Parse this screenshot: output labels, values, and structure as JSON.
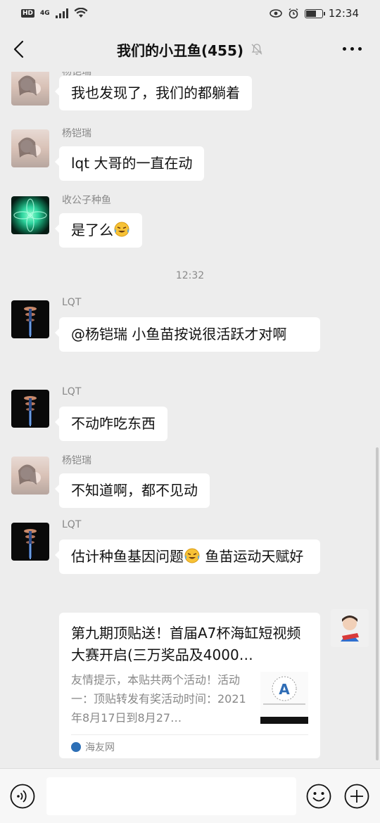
{
  "status_bar": {
    "hd_badge": "HD",
    "network": "4G",
    "time": "12:34",
    "battery_level": 0.65
  },
  "header": {
    "title": "我们的小丑鱼(455)",
    "muted": true
  },
  "messages": [
    {
      "sender": "杨铠瑞",
      "text": "我也发现了，我们的都躺着",
      "avatar": "girl"
    },
    {
      "sender": "杨铠瑞",
      "text": "lqt 大哥的一直在动",
      "avatar": "girl"
    },
    {
      "sender": "收公子种鱼",
      "text": "是了么",
      "emoji": "laugh-cry",
      "avatar": "lotus"
    },
    {
      "sender": "LQT",
      "text": "@杨铠瑞  小鱼苗按说很活跃才对啊",
      "avatar": "lqt"
    },
    {
      "sender": "LQT",
      "text": "不动咋吃东西",
      "avatar": "lqt"
    },
    {
      "sender": "杨铠瑞",
      "text": "不知道啊，都不见动",
      "avatar": "girl"
    },
    {
      "sender": "LQT",
      "text_before_emoji": "估计种鱼基因问题",
      "text_after_emoji": " 鱼苗运动天赋好",
      "emoji": "laugh-cry",
      "avatar": "lqt"
    }
  ],
  "timestamp": "12:32",
  "shared_card": {
    "title": "第九期顶贴送！首届A7杯海缸短视频大赛开启(三万奖品及4000…",
    "description": "友情提示，本贴共两个活动！活动一：顶贴转发有奖活动时间：2021年8月17日到8月27…",
    "source": "海友网"
  },
  "input_bar": {
    "placeholder": ""
  },
  "colors": {
    "background": "#ededed",
    "bubble": "#ffffff",
    "secondary_text": "#888888"
  }
}
